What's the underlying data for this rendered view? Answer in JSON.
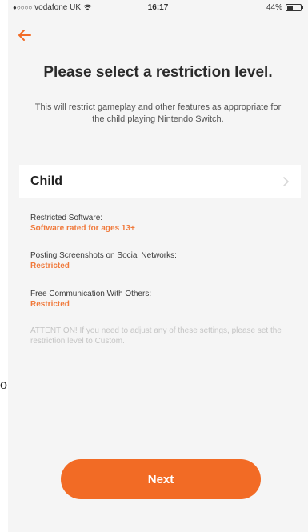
{
  "status_bar": {
    "signal": "●○○○○",
    "carrier": "vodafone UK",
    "time": "16:17",
    "battery_percent": "44%",
    "battery_level": 0.44
  },
  "header": {
    "back_icon": "back-arrow-icon"
  },
  "title": "Please select a restriction level.",
  "subtitle": "This will restrict gameplay and other features as appropriate for the child playing Nintendo Switch.",
  "restriction_level": {
    "label": "Child",
    "icon": "chevron-right-icon"
  },
  "settings": [
    {
      "label": "Restricted Software:",
      "value": "Software rated for ages 13+"
    },
    {
      "label": "Posting Screenshots on Social Networks:",
      "value": "Restricted"
    },
    {
      "label": "Free Communication With Others:",
      "value": "Restricted"
    }
  ],
  "attention": "ATTENTION! If you need to adjust any of these settings, please set the restriction level to Custom.",
  "next_button": "Next",
  "stray_text": "o",
  "colors": {
    "accent": "#f26b25",
    "value_text": "#f07a3c",
    "background": "#f5f5f5"
  }
}
